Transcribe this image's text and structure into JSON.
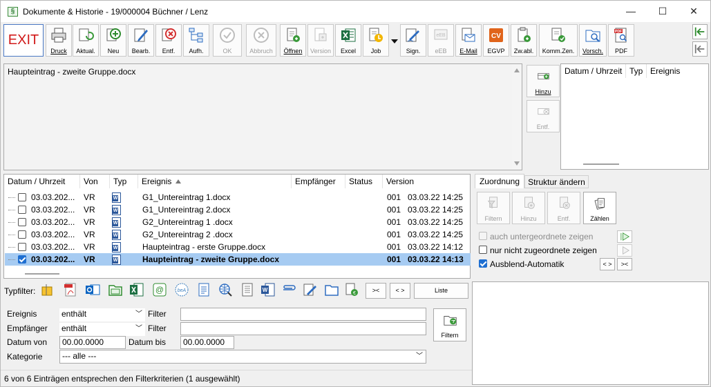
{
  "window": {
    "title": "Dokumente & Historie - 19/000004 Büchner / Lenz",
    "app_icon": "§",
    "controls": {
      "minimize": "—",
      "maximize": "☐",
      "close": "✕"
    }
  },
  "toolbar": {
    "exit": "EXIT",
    "buttons": [
      {
        "label": "Druck",
        "icon": "printer-icon",
        "enabled": true
      },
      {
        "label": "Aktual.",
        "icon": "refresh-icon",
        "enabled": true
      },
      {
        "label": "Neu",
        "icon": "add-icon",
        "enabled": true
      },
      {
        "label": "Bearb.",
        "icon": "edit-icon",
        "enabled": true
      },
      {
        "label": "Entf.",
        "icon": "delete-icon",
        "enabled": true
      },
      {
        "label": "Aufh.",
        "icon": "tree-icon",
        "enabled": true
      },
      {
        "label": "OK",
        "icon": "check-icon",
        "enabled": false
      },
      {
        "label": "Abbruch",
        "icon": "cancel-icon",
        "enabled": false
      },
      {
        "label": "Öffnen",
        "icon": "open-doc-icon",
        "enabled": true
      },
      {
        "label": "Version",
        "icon": "version-icon",
        "enabled": false
      },
      {
        "label": "Excel",
        "icon": "excel-icon",
        "enabled": true
      },
      {
        "label": "Job",
        "icon": "job-icon",
        "enabled": true
      },
      {
        "label": "Sign.",
        "icon": "sign-icon",
        "enabled": true
      },
      {
        "label": "eEB",
        "icon": "eeb-icon",
        "enabled": false
      },
      {
        "label": "E-Mail",
        "icon": "email-icon",
        "enabled": true
      },
      {
        "label": "EGVP",
        "icon": "egvp-icon",
        "enabled": true
      },
      {
        "label": "Zw.abl.",
        "icon": "clipboard-icon",
        "enabled": true
      },
      {
        "label": "Komm.Zen.",
        "icon": "comm-center-icon",
        "enabled": true
      },
      {
        "label": "Vorsch.",
        "icon": "preview-icon",
        "enabled": true
      },
      {
        "label": "PDF",
        "icon": "pdf-icon",
        "enabled": true
      }
    ]
  },
  "preview": {
    "text": "Haupteintrag - zweite Gruppe.docx"
  },
  "side_buttons": {
    "add": "Hinzu",
    "remove": "Entf."
  },
  "history": {
    "columns": [
      "Datum / Uhrzeit",
      "Typ",
      "Ereignis"
    ]
  },
  "table": {
    "columns": [
      "Datum / Uhrzeit",
      "Von",
      "Typ",
      "Ereignis",
      "Empfänger",
      "Status",
      "Version"
    ],
    "rows": [
      {
        "date": "03.03.202...",
        "von": "VR",
        "ereignis": "G1_Untereintrag 1.docx",
        "version": "001",
        "time": "03.03.22 14:25",
        "checked": false,
        "selected": false
      },
      {
        "date": "03.03.202...",
        "von": "VR",
        "ereignis": "G1_Untereintrag 2.docx",
        "version": "001",
        "time": "03.03.22 14:25",
        "checked": false,
        "selected": false
      },
      {
        "date": "03.03.202...",
        "von": "VR",
        "ereignis": "G2_Untereintrag 1 .docx",
        "version": "001",
        "time": "03.03.22 14:25",
        "checked": false,
        "selected": false
      },
      {
        "date": "03.03.202...",
        "von": "VR",
        "ereignis": "G2_Untereintrag 2 .docx",
        "version": "001",
        "time": "03.03.22 14:25",
        "checked": false,
        "selected": false
      },
      {
        "date": "03.03.202...",
        "von": "VR",
        "ereignis": "Haupteintrag - erste Gruppe.docx",
        "version": "001",
        "time": "03.03.22 14:12",
        "checked": false,
        "selected": false
      },
      {
        "date": "03.03.202...",
        "von": "VR",
        "ereignis": "Haupteintrag - zweite Gruppe.docx",
        "version": "001",
        "time": "03.03.22 14:13",
        "checked": true,
        "selected": true
      }
    ]
  },
  "right_panel": {
    "tabs": [
      "Zuordnung",
      "Struktur ändern"
    ],
    "buttons": [
      "Filtern",
      "Hinzu",
      "Entf.",
      "Zählen"
    ],
    "checks": [
      {
        "label": "auch untergeordnete zeigen",
        "checked": false,
        "enabled": false
      },
      {
        "label": "nur nicht zugeordnete zeigen",
        "checked": false,
        "enabled": true
      },
      {
        "label": "Ausblend-Automatik",
        "checked": true,
        "enabled": true
      }
    ],
    "expand": "< >",
    "collapse": "><"
  },
  "typfilter": {
    "label": "Typfilter:",
    "collapse": "><",
    "expand": "< >",
    "list": "Liste"
  },
  "filter": {
    "ereignis_label": "Ereignis",
    "empfaenger_label": "Empfänger",
    "op": "enthält",
    "filter_label": "Filter",
    "datum_von_label": "Datum von",
    "datum_von": "00.00.0000",
    "datum_bis_label": "Datum bis",
    "datum_bis": "00.00.0000",
    "kategorie_label": "Kategorie",
    "kategorie": "--- alle ---",
    "button": "Filtern"
  },
  "status": "6 von 6 Einträgen entsprechen den Filterkriterien (1 ausgewählt)"
}
